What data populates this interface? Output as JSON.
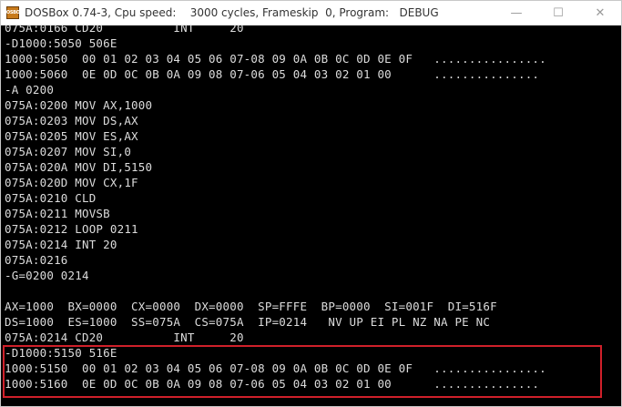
{
  "window": {
    "title": "DOSBox 0.74-3, Cpu speed:    3000 cycles, Frameskip  0, Program:   DEBUG",
    "icon_text": "DOSBOX",
    "controls": [
      "minimize-icon",
      "maximize-icon",
      "close-icon"
    ],
    "minimize_glyph": "—",
    "maximize_glyph": "☐",
    "close_glyph": "✕"
  },
  "terminal": {
    "lines": [
      "075A:0166 CD20          INT     20",
      "-D1000:5050 506E",
      "1000:5050  00 01 02 03 04 05 06 07-08 09 0A 0B 0C 0D 0E 0F   ................",
      "1000:5060  0E 0D 0C 0B 0A 09 08 07-06 05 04 03 02 01 00      ...............",
      "-A 0200",
      "075A:0200 MOV AX,1000",
      "075A:0203 MOV DS,AX",
      "075A:0205 MOV ES,AX",
      "075A:0207 MOV SI,0",
      "075A:020A MOV DI,5150",
      "075A:020D MOV CX,1F",
      "075A:0210 CLD",
      "075A:0211 MOVSB",
      "075A:0212 LOOP 0211",
      "075A:0214 INT 20",
      "075A:0216",
      "-G=0200 0214",
      "",
      "AX=1000  BX=0000  CX=0000  DX=0000  SP=FFFE  BP=0000  SI=001F  DI=516F",
      "DS=1000  ES=1000  SS=075A  CS=075A  IP=0214   NV UP EI PL NZ NA PE NC",
      "075A:0214 CD20          INT     20",
      "-D1000:5150 516E",
      "1000:5150  00 01 02 03 04 05 06 07-08 09 0A 0B 0C 0D 0E 0F   ................",
      "1000:5160  0E 0D 0C 0B 0A 09 08 07-06 05 04 03 02 01 00      ..............."
    ]
  },
  "colors": {
    "terminal_bg": "#000000",
    "terminal_fg": "#dcdcdc",
    "highlight_border": "#d0202a"
  }
}
